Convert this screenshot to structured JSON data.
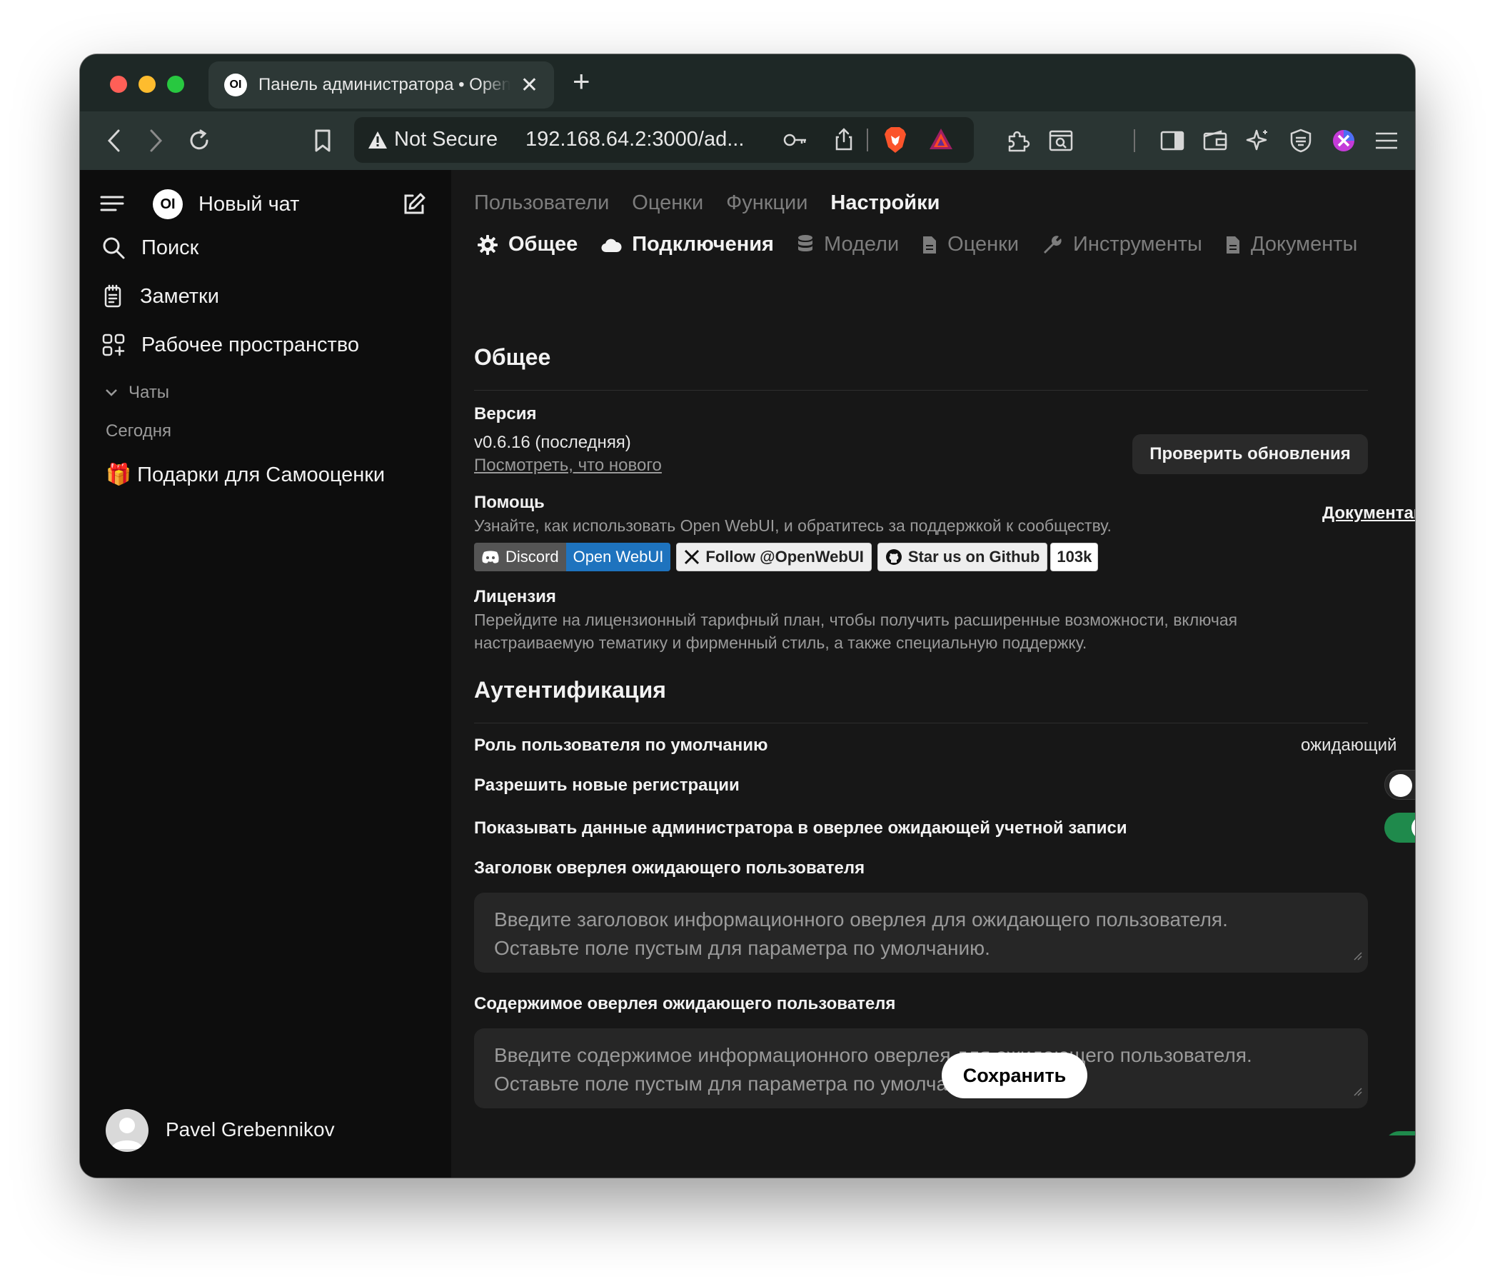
{
  "browser": {
    "tab_title": "Панель администратора • Open WebUI",
    "tab_icon_text": "OI",
    "not_secure": "Not Secure",
    "url": "192.168.64.2:3000/ad..."
  },
  "sidebar": {
    "logo_text": "OI",
    "new_chat": "Новый чат",
    "items": [
      {
        "label": "Поиск",
        "icon": "search-icon"
      },
      {
        "label": "Заметки",
        "icon": "notes-icon"
      },
      {
        "label": "Рабочее пространство",
        "icon": "workspace-icon"
      }
    ],
    "chats_label": "Чаты",
    "today_label": "Сегодня",
    "chat_item": "🎁 Подарки для Самооценки",
    "user_name": "Pavel Grebennikov"
  },
  "main": {
    "top_tabs": [
      "Пользователи",
      "Оценки",
      "Функции",
      "Настройки"
    ],
    "active_top_tab": "Настройки",
    "sub_tabs": [
      {
        "label": "Общее",
        "icon": "gear-icon"
      },
      {
        "label": "Подключения",
        "icon": "cloud-icon"
      },
      {
        "label": "Модели",
        "icon": "database-icon"
      },
      {
        "label": "Оценки",
        "icon": "document-icon"
      },
      {
        "label": "Инструменты",
        "icon": "wrench-icon"
      },
      {
        "label": "Документы",
        "icon": "document-icon"
      }
    ],
    "general": {
      "title": "Общее",
      "version_label": "Версия",
      "version_value": "v0.6.16 (последняя)",
      "whats_new": "Посмотреть, что нового",
      "check_updates": "Проверить обновления",
      "help_label": "Помощь",
      "help_text": "Узнайте, как использовать Open WebUI, и обратитесь за поддержкой к сообществу.",
      "docs_link": "Документация",
      "badges": {
        "discord_left": "Discord",
        "discord_right": "Open WebUI",
        "x_follow": "Follow @OpenWebUI",
        "github_star": "Star us on Github",
        "github_count": "103k"
      },
      "license_label": "Лицензия",
      "license_text_1": "Перейдите на лицензионный тарифный план, чтобы получить расширенные возможности, включая",
      "license_text_2": "настраиваемую тематику и фирменный стиль, а также специальную поддержку."
    },
    "auth": {
      "title": "Аутентификация",
      "default_role_label": "Роль пользователя по умолчанию",
      "default_role_value": "ожидающий",
      "allow_signups_label": "Разрешить новые регистрации",
      "allow_signups": false,
      "show_admin_label": "Показывать данные администратора в оверлее ожидающей учетной записи",
      "show_admin": true,
      "overlay_title_label": "Заголовк оверлея ожидающего пользователя",
      "overlay_title_placeholder_1": "Введите заголовок информационного оверлея для ожидающего пользователя.",
      "overlay_title_placeholder_2": "Оставьте поле пустым для параметра по умолчанию.",
      "overlay_content_label": "Содержимое оверлея ожидающего пользователя",
      "overlay_content_placeholder_1": "Введите содержимое информационного оверлея для ожидающего пользователя.",
      "overlay_content_placeholder_2": "Оставьте поле пустым для параметра по умолчанию."
    },
    "save_label": "Сохранить"
  },
  "colors": {
    "toggle_on": "#1f8a4c",
    "badge_blue": "#1e73be",
    "window_bg": "#171717",
    "sidebar_bg": "#0d0d0d"
  }
}
